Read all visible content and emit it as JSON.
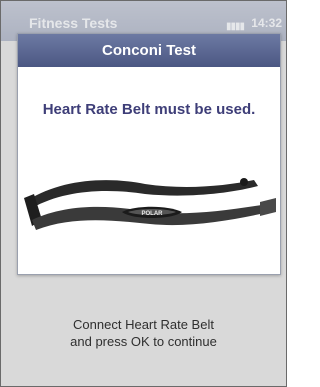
{
  "app_bar": {
    "title": "Fitness Tests",
    "signal": "▮▮▮▮",
    "time": "14:32"
  },
  "dialog": {
    "title": "Conconi Test",
    "message": "Heart Rate Belt must be used.",
    "image": {
      "icon": "heart-rate-belt-image",
      "brand_text": "POLAR"
    }
  },
  "footer": {
    "line1": "Connect Heart Rate Belt",
    "line2": "and press OK to continue"
  }
}
